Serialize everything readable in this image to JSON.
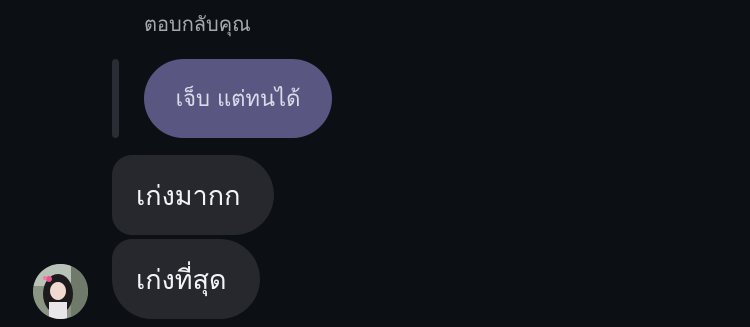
{
  "reply": {
    "header_label": "ตอบกลับคุณ",
    "quoted_text": "เจ็บ แต่ทนได้"
  },
  "messages": [
    {
      "text": "เก่งมากก"
    },
    {
      "text": "เก่งที่สุด"
    }
  ],
  "avatar": {
    "icon": "profile-photo-avatar"
  },
  "colors": {
    "background": "#0c0f14",
    "quoted_bubble": "#5a5682",
    "message_bubble": "#26282d",
    "header_text": "#a6a9b0",
    "message_text": "#f2f3f5"
  }
}
